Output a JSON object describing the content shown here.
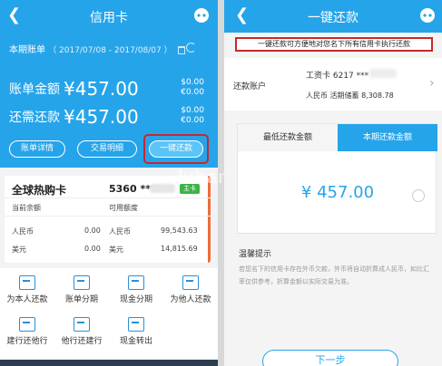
{
  "left": {
    "title": "信用卡",
    "period_label": "本期账单",
    "period_dates": "（ 2017/07/08 - 2017/08/07 ）",
    "bill_amount_label": "账单金额",
    "bill_amount": "¥457.00",
    "bill_amount_sub": [
      "$0.00",
      "€0.00"
    ],
    "due_amount_label": "还需还款",
    "due_amount": "¥457.00",
    "due_amount_sub": [
      "$0.00",
      "€0.00"
    ],
    "buttons": {
      "bill_detail": "账单详情",
      "transactions": "交易明细",
      "one_key_repay": "一键还款"
    },
    "card": {
      "name": "全球热购卡",
      "number": "5360 ***",
      "badge": "主卡",
      "col1_header": "当前余额",
      "col2_header": "可用额度",
      "rows": [
        {
          "cur": "人民币",
          "balance": "0.00",
          "cur2": "人民币",
          "limit": "99,543.63"
        },
        {
          "cur": "美元",
          "balance": "0.00",
          "cur2": "美元",
          "limit": "14,815.69"
        }
      ]
    },
    "grid": [
      {
        "label": "为本人还款"
      },
      {
        "label": "账单分期"
      },
      {
        "label": "现金分期"
      },
      {
        "label": "为他人还款"
      },
      {
        "label": "建行还他行"
      },
      {
        "label": "他行还建行"
      },
      {
        "label": "现金转出"
      }
    ]
  },
  "right": {
    "title": "一键还款",
    "notice": "一键还款可方便地对您名下所有信用卡执行还款",
    "account_label": "还款账户",
    "account_line1": "工资卡  6217 ***",
    "account_line2": "人民币  活期储蓄   8,308.78",
    "tabs": {
      "min": "最低还款金额",
      "full": "本期还款金额"
    },
    "amount": "¥ 457.00",
    "tip_title": "温馨提示",
    "tip_text": "若您名下的信用卡存在外币欠款，外币将自动折算成人民币，如比汇率仅供参考，折算金额以实际交易为准。",
    "next_button": "下一步"
  },
  "watermark": "lvbang",
  "colors": {
    "accent": "#26a4ea",
    "highlight": "#c9272d"
  }
}
